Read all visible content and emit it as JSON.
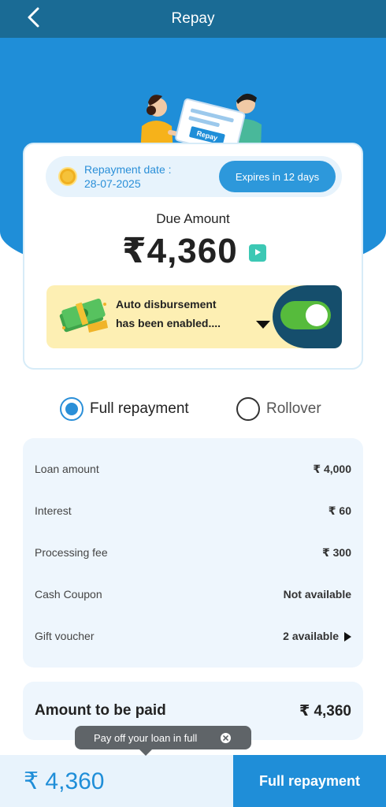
{
  "header": {
    "title": "Repay"
  },
  "illustration": {
    "badge_text": "Repay"
  },
  "card": {
    "repayment_date_label": "Repayment date :",
    "repayment_date_value": "28-07-2025",
    "expires_label": "Expires in 12 days",
    "due_label": "Due Amount",
    "due_amount": "₹4,360",
    "auto_disbursement_line1": "Auto disbursement",
    "auto_disbursement_line2": "has been enabled....",
    "auto_disbursement_enabled": true
  },
  "options": {
    "full_repayment_label": "Full repayment",
    "rollover_label": "Rollover",
    "selected": "full_repayment"
  },
  "breakdown": {
    "rows": [
      {
        "label": "Loan amount",
        "value": "₹ 4,000"
      },
      {
        "label": "Interest",
        "value": "₹ 60"
      },
      {
        "label": "Processing fee",
        "value": "₹ 300"
      },
      {
        "label": "Cash Coupon",
        "value": "Not available"
      },
      {
        "label": "Gift voucher",
        "value": "2 available"
      }
    ]
  },
  "total": {
    "label": "Amount to be paid",
    "value": "₹ 4,360"
  },
  "tooltip": {
    "text": "Pay off your loan in full"
  },
  "bottom": {
    "amount": "₹ 4,360",
    "button_label": "Full repayment"
  },
  "colors": {
    "header": "#1a6b95",
    "primary": "#1f8ed8",
    "toggle_on": "#56bb3c",
    "notice_bg": "#fdefb3"
  }
}
